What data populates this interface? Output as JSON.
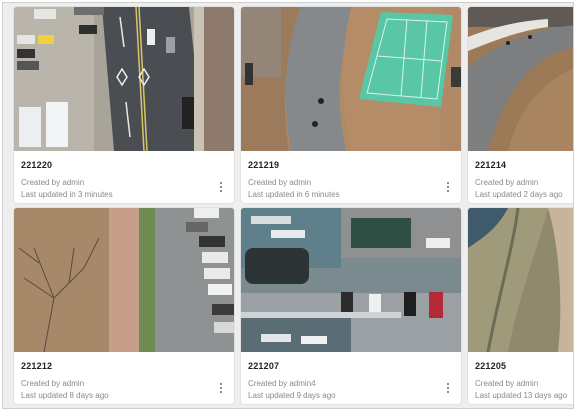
{
  "cards": [
    {
      "title": "221220",
      "created": "Created by admin",
      "updated": "Last updated in 3 minutes",
      "thumbnail": "aerial-road-intersection"
    },
    {
      "title": "221219",
      "created": "Created by admin",
      "updated": "Last updated in 6 minutes",
      "thumbnail": "aerial-tennis-court"
    },
    {
      "title": "221214",
      "created": "Created by admin",
      "updated": "Last updated 2 days ago",
      "thumbnail": "aerial-path-grass"
    },
    {
      "title": "221212",
      "created": "Created by admin",
      "updated": "Last updated 8 days ago",
      "thumbnail": "aerial-parking-sidewalk"
    },
    {
      "title": "221207",
      "created": "Created by admin4",
      "updated": "Last updated 9 days ago",
      "thumbnail": "aerial-harbor"
    },
    {
      "title": "221205",
      "created": "Created by admin",
      "updated": "Last updated 13 days ago",
      "thumbnail": "aerial-coastline"
    }
  ],
  "icons": {
    "more": "more-vertical-icon"
  }
}
